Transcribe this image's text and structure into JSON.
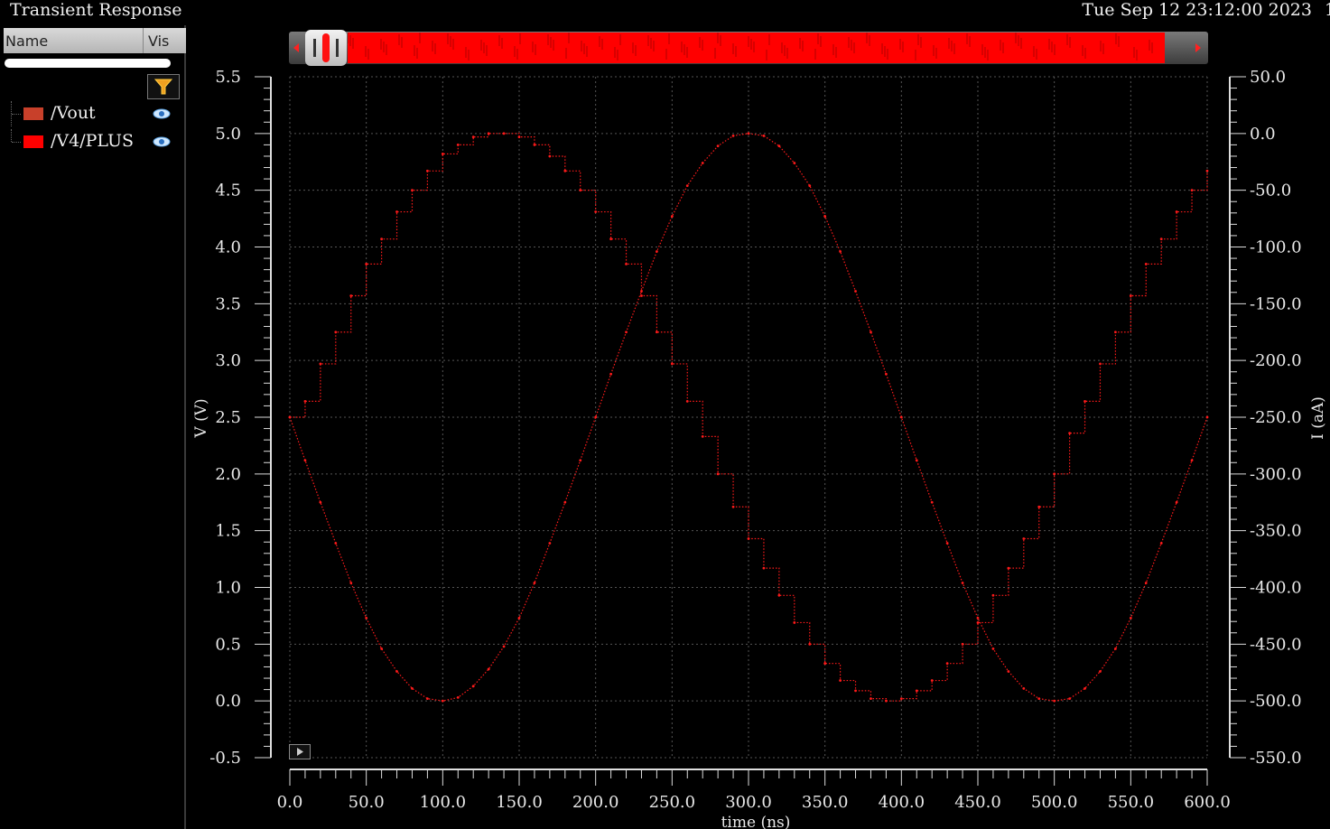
{
  "window": {
    "title": "Transient Response",
    "timestamp": "Tue Sep 12 23:12:00 2023",
    "timestamp_tail": "1"
  },
  "legend": {
    "columns": {
      "name": "Name",
      "vis": "Vis"
    },
    "filter_icon": "filter-funnel-icon",
    "items": [
      {
        "label": "/Vout",
        "color": "#c8402a",
        "visible_icon": "eye-icon"
      },
      {
        "label": "/V4/PLUS",
        "color": "#ff0000",
        "visible_icon": "eye-icon"
      }
    ]
  },
  "colors": {
    "background": "#000000",
    "grid": "#555555",
    "trace": "#ff1a1a",
    "scroll_range": "#ff0000"
  },
  "chart_data": {
    "type": "line",
    "xlabel": "time (ns)",
    "ylabel": "V (V)",
    "y2label": "I (aA)",
    "xlim": [
      0,
      600
    ],
    "ylim": [
      -0.5,
      5.5
    ],
    "y2lim": [
      -550,
      50
    ],
    "x_ticks": [
      "0.0",
      "50.0",
      "100.0",
      "150.0",
      "200.0",
      "250.0",
      "300.0",
      "350.0",
      "400.0",
      "450.0",
      "500.0",
      "550.0",
      "600.0"
    ],
    "y_ticks": [
      "-0.5",
      "0.0",
      "0.5",
      "1.0",
      "1.5",
      "2.0",
      "2.5",
      "3.0",
      "3.5",
      "4.0",
      "4.5",
      "5.0",
      "5.5"
    ],
    "y2_ticks": [
      "-550.0",
      "-500.0",
      "-450.0",
      "-400.0",
      "-350.0",
      "-300.0",
      "-250.0",
      "-200.0",
      "-150.0",
      "-100.0",
      "-50.0",
      "0.0",
      "50.0"
    ],
    "grid": true,
    "series": [
      {
        "name": "/Vout",
        "style": "staircase",
        "x": [
          0,
          10,
          20,
          30,
          40,
          50,
          60,
          70,
          80,
          90,
          100,
          110,
          120,
          130,
          140,
          150,
          160,
          170,
          180,
          190,
          200,
          210,
          220,
          230,
          240,
          250,
          260,
          270,
          280,
          290,
          300,
          310,
          320,
          330,
          340,
          350,
          360,
          370,
          380,
          390,
          400,
          410,
          420,
          430,
          440,
          450,
          460,
          470,
          480,
          490,
          500,
          510,
          520,
          530,
          540,
          550,
          560,
          570,
          580,
          590,
          600
        ],
        "y": [
          2.5,
          2.64,
          2.97,
          3.25,
          3.57,
          3.85,
          4.07,
          4.31,
          4.5,
          4.67,
          4.82,
          4.9,
          4.97,
          5.0,
          5.0,
          4.97,
          4.9,
          4.8,
          4.67,
          4.5,
          4.31,
          4.07,
          3.85,
          3.57,
          3.25,
          2.97,
          2.64,
          2.33,
          2.0,
          1.71,
          1.43,
          1.17,
          0.93,
          0.69,
          0.5,
          0.33,
          0.18,
          0.09,
          0.02,
          0.0,
          0.02,
          0.09,
          0.18,
          0.33,
          0.5,
          0.69,
          0.93,
          1.17,
          1.43,
          1.71,
          2.0,
          2.36,
          2.64,
          2.97,
          3.25,
          3.57,
          3.85,
          4.07,
          4.31,
          4.5,
          4.67
        ]
      },
      {
        "name": "/V4/PLUS",
        "style": "smooth",
        "x": [
          0,
          10,
          20,
          30,
          40,
          50,
          60,
          70,
          80,
          90,
          100,
          110,
          120,
          130,
          140,
          150,
          160,
          170,
          180,
          190,
          200,
          210,
          220,
          230,
          240,
          250,
          260,
          270,
          280,
          290,
          300,
          310,
          320,
          330,
          340,
          350,
          360,
          370,
          380,
          390,
          400,
          410,
          420,
          430,
          440,
          450,
          460,
          470,
          480,
          490,
          500,
          510,
          520,
          530,
          540,
          550,
          560,
          570,
          580,
          590,
          600
        ],
        "y": [
          2.5,
          2.12,
          1.75,
          1.39,
          1.04,
          0.73,
          0.46,
          0.26,
          0.11,
          0.02,
          0.0,
          0.03,
          0.13,
          0.28,
          0.48,
          0.73,
          1.04,
          1.39,
          1.75,
          2.12,
          2.5,
          2.88,
          3.25,
          3.61,
          3.96,
          4.27,
          4.54,
          4.74,
          4.89,
          4.98,
          5.0,
          4.98,
          4.89,
          4.74,
          4.54,
          4.27,
          3.96,
          3.61,
          3.25,
          2.88,
          2.5,
          2.12,
          1.75,
          1.39,
          1.04,
          0.73,
          0.46,
          0.26,
          0.11,
          0.02,
          0.0,
          0.02,
          0.11,
          0.26,
          0.46,
          0.73,
          1.04,
          1.39,
          1.75,
          2.12,
          2.5
        ]
      }
    ]
  }
}
